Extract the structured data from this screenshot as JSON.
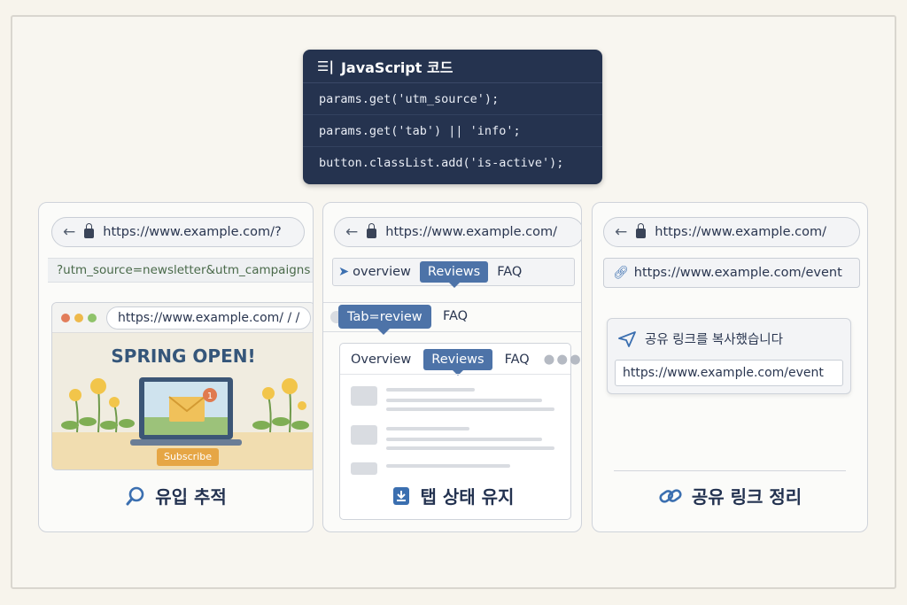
{
  "code": {
    "title": "JavaScript 코드",
    "lines": [
      "params.get('utm_source');",
      "params.get('tab') || 'info';",
      "button.classList.add('is-active');"
    ]
  },
  "panel1": {
    "url": "https://www.example.com/?",
    "query": "?utm_source=newsletter&utm_campaigns",
    "mini_url": "https://www.example.com/ / /",
    "banner": "SPRING OPEN!",
    "badge": "1",
    "subscribe": "Subscribe",
    "label": "유입 추적"
  },
  "panel2": {
    "url": "https://www.example.com/",
    "tabs_top": [
      "overview",
      "Reviews",
      "FAQ"
    ],
    "pill": "Tab=review",
    "pill_faq": "FAQ",
    "tabs_inner": [
      "Overview",
      "Reviews",
      "FAQ"
    ],
    "label": "탭 상태 유지"
  },
  "panel3": {
    "url": "https://www.example.com/",
    "link": "https://www.example.com/event",
    "copied_msg": "공유 링크를 복사했습니다",
    "copied_url": "https://www.example.com/event",
    "label": "공유 링크 정리"
  },
  "colors": {
    "navy": "#25334f",
    "accent_blue": "#4d73a8",
    "orange": "#e6a645"
  }
}
